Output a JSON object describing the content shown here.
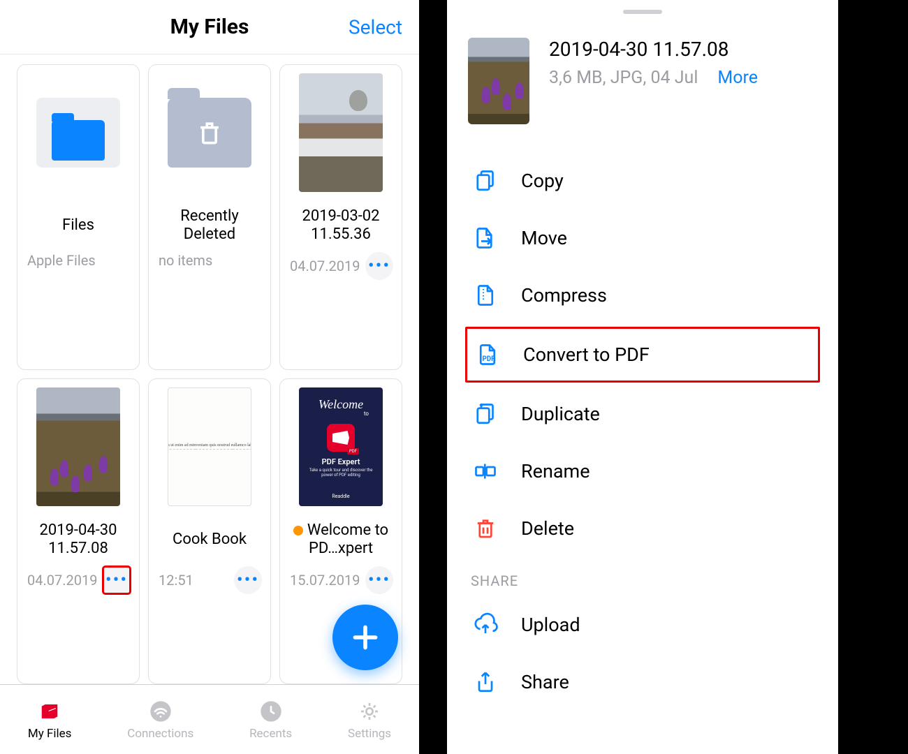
{
  "left": {
    "title": "My Files",
    "select": "Select",
    "cards": [
      {
        "name": "Files",
        "meta": "Apple Files"
      },
      {
        "name": "Recently Deleted",
        "meta": "no items"
      },
      {
        "name": "2019-03-02 11.55.36",
        "meta": "04.07.2019"
      },
      {
        "name": "2019-04-30 11.57.08",
        "meta": "04.07.2019"
      },
      {
        "name": "Cook Book",
        "meta": "12:51"
      },
      {
        "name": "Welcome to PD…xpert",
        "meta": "15.07.2019"
      }
    ],
    "pdf_thumb": {
      "welcome": "Welcome",
      "to": "to",
      "title": "PDF Expert",
      "sub": "Take a quick tour and discover the power of PDF editing",
      "brand": "Readdle",
      "pdf_badge": "PDF"
    },
    "tabs": {
      "myfiles": "My Files",
      "connections": "Connections",
      "recents": "Recents",
      "settings": "Settings"
    }
  },
  "right": {
    "file": {
      "title": "2019-04-30 11.57.08",
      "sub": "3,6 MB, JPG, 04 Jul",
      "more": "More"
    },
    "actions": {
      "copy": "Copy",
      "move": "Move",
      "compress": "Compress",
      "convert": "Convert to PDF",
      "duplicate": "Duplicate",
      "rename": "Rename",
      "delete": "Delete"
    },
    "share_label": "SHARE",
    "share": {
      "upload": "Upload",
      "share": "Share"
    }
  }
}
